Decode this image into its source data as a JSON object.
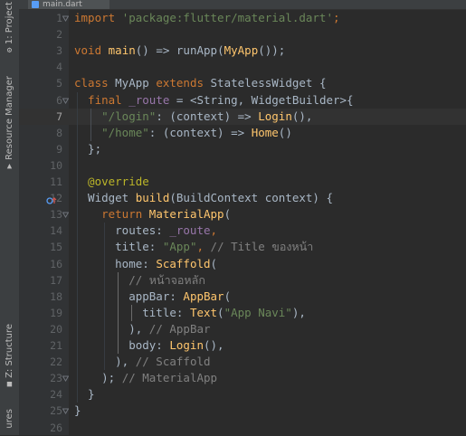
{
  "tab": {
    "file_name": "main.dart"
  },
  "left_strip": {
    "project_label": "1: Project",
    "resource_manager_label": "Resource Manager",
    "structure_label": "Z: Structure",
    "bottom_label": "ures"
  },
  "editor": {
    "active_line": 7,
    "lines": [
      {
        "n": "1",
        "segs": [
          {
            "t": "import ",
            "c": "kw"
          },
          {
            "t": "'package:flutter/material.dart'",
            "c": "str"
          },
          {
            "t": ";",
            "c": "kw"
          }
        ]
      },
      {
        "n": "2",
        "segs": []
      },
      {
        "n": "3",
        "segs": [
          {
            "t": "void ",
            "c": "kw"
          },
          {
            "t": "main",
            "c": "fn"
          },
          {
            "t": "() => ",
            "c": "cls"
          },
          {
            "t": "runApp",
            "c": "cls"
          },
          {
            "t": "(",
            "c": "cls"
          },
          {
            "t": "MyApp",
            "c": "fn"
          },
          {
            "t": "());",
            "c": "cls"
          }
        ]
      },
      {
        "n": "4",
        "segs": []
      },
      {
        "n": "5",
        "segs": [
          {
            "t": "class ",
            "c": "kw"
          },
          {
            "t": "MyApp ",
            "c": "cls"
          },
          {
            "t": "extends ",
            "c": "kw"
          },
          {
            "t": "StatelessWidget {",
            "c": "cls"
          }
        ]
      },
      {
        "n": "6",
        "segs": [
          {
            "t": "  final ",
            "c": "kw"
          },
          {
            "t": "_route",
            "c": "prm"
          },
          {
            "t": " = <String, WidgetBuilder>{",
            "c": "cls"
          }
        ]
      },
      {
        "n": "7",
        "segs": [
          {
            "t": "    ",
            "c": "cls"
          },
          {
            "t": "\"/login\"",
            "c": "str"
          },
          {
            "t": ": (context) => ",
            "c": "cls"
          },
          {
            "t": "Login",
            "c": "fn"
          },
          {
            "t": "(),",
            "c": "cls"
          }
        ]
      },
      {
        "n": "8",
        "segs": [
          {
            "t": "    ",
            "c": "cls"
          },
          {
            "t": "\"/home\"",
            "c": "str"
          },
          {
            "t": ": (context) => ",
            "c": "cls"
          },
          {
            "t": "Home",
            "c": "fn"
          },
          {
            "t": "()",
            "c": "cls"
          }
        ]
      },
      {
        "n": "9",
        "segs": [
          {
            "t": "  };",
            "c": "cls"
          }
        ]
      },
      {
        "n": "10",
        "segs": []
      },
      {
        "n": "11",
        "segs": [
          {
            "t": "  @override",
            "c": "ann"
          }
        ]
      },
      {
        "n": "12",
        "segs": [
          {
            "t": "  Widget ",
            "c": "cls"
          },
          {
            "t": "build",
            "c": "fn"
          },
          {
            "t": "(BuildContext context) {",
            "c": "cls"
          }
        ]
      },
      {
        "n": "13",
        "segs": [
          {
            "t": "    ",
            "c": "cls"
          },
          {
            "t": "return ",
            "c": "kw"
          },
          {
            "t": "MaterialApp",
            "c": "fn"
          },
          {
            "t": "(",
            "c": "cls"
          }
        ]
      },
      {
        "n": "14",
        "segs": [
          {
            "t": "      routes: ",
            "c": "cls"
          },
          {
            "t": "_route",
            "c": "prm"
          },
          {
            "t": ",",
            "c": "kw"
          }
        ]
      },
      {
        "n": "15",
        "segs": [
          {
            "t": "      title: ",
            "c": "cls"
          },
          {
            "t": "\"App\"",
            "c": "str"
          },
          {
            "t": ", ",
            "c": "kw"
          },
          {
            "t": "// Title ของหน้า",
            "c": "cmt"
          }
        ]
      },
      {
        "n": "16",
        "segs": [
          {
            "t": "      home: ",
            "c": "cls"
          },
          {
            "t": "Scaffold",
            "c": "fn"
          },
          {
            "t": "(",
            "c": "cls"
          }
        ]
      },
      {
        "n": "17",
        "segs": [
          {
            "t": "        ",
            "c": "cls"
          },
          {
            "t": "// หน้าจอหลัก",
            "c": "cmt"
          }
        ]
      },
      {
        "n": "18",
        "segs": [
          {
            "t": "        appBar: ",
            "c": "cls"
          },
          {
            "t": "AppBar",
            "c": "fn"
          },
          {
            "t": "(",
            "c": "cls"
          }
        ]
      },
      {
        "n": "19",
        "segs": [
          {
            "t": "          title: ",
            "c": "cls"
          },
          {
            "t": "Text",
            "c": "fn"
          },
          {
            "t": "(",
            "c": "cls"
          },
          {
            "t": "\"App Navi\"",
            "c": "str"
          },
          {
            "t": "),",
            "c": "cls"
          }
        ]
      },
      {
        "n": "20",
        "segs": [
          {
            "t": "        ), ",
            "c": "cls"
          },
          {
            "t": "// AppBar",
            "c": "cmt"
          }
        ]
      },
      {
        "n": "21",
        "segs": [
          {
            "t": "        body: ",
            "c": "cls"
          },
          {
            "t": "Login",
            "c": "fn"
          },
          {
            "t": "(),",
            "c": "cls"
          }
        ]
      },
      {
        "n": "22",
        "segs": [
          {
            "t": "      ), ",
            "c": "cls"
          },
          {
            "t": "// Scaffold",
            "c": "cmt"
          }
        ]
      },
      {
        "n": "23",
        "segs": [
          {
            "t": "    ); ",
            "c": "cls"
          },
          {
            "t": "// MaterialApp",
            "c": "cmt"
          }
        ]
      },
      {
        "n": "24",
        "segs": [
          {
            "t": "  }",
            "c": "cls"
          }
        ]
      },
      {
        "n": "25",
        "segs": [
          {
            "t": "}",
            "c": "cls"
          }
        ]
      },
      {
        "n": "26",
        "segs": []
      }
    ]
  }
}
